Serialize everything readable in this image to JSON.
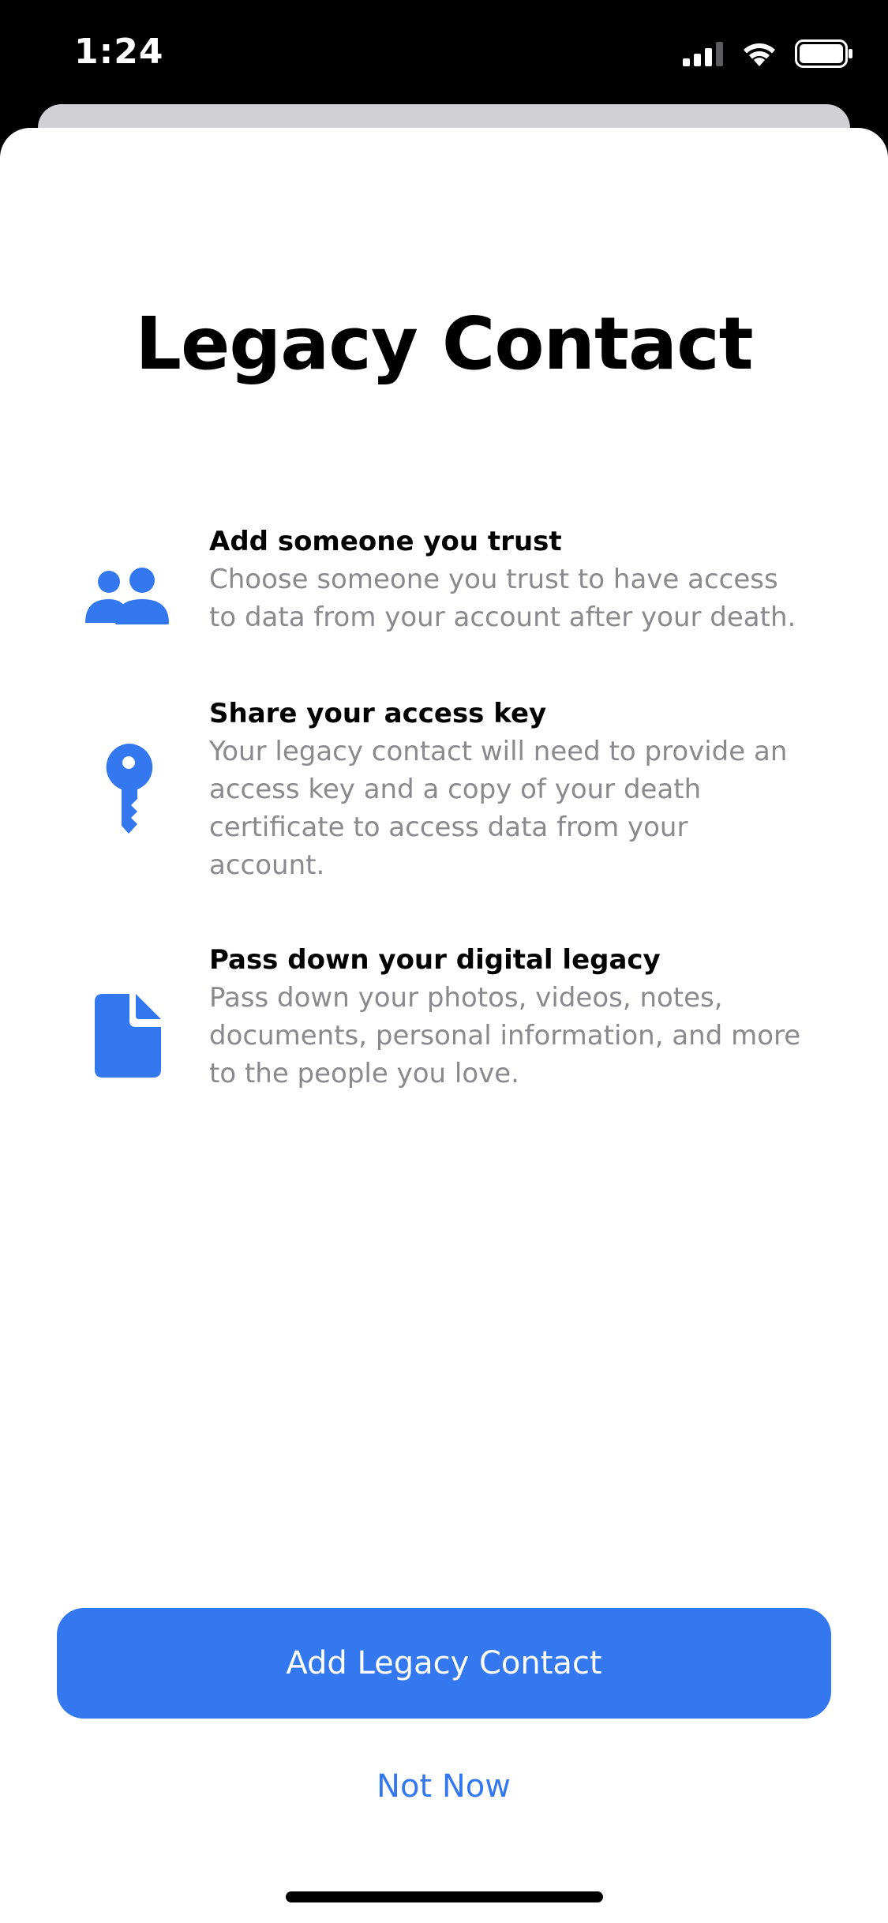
{
  "status_bar": {
    "time": "1:24",
    "icons": [
      "cellular-signal-icon",
      "wifi-icon",
      "battery-icon"
    ]
  },
  "page": {
    "title": "Legacy Contact"
  },
  "features": [
    {
      "icon": "people-icon",
      "title": "Add someone you trust",
      "desc_lines": [
        "Choose someone you trust to have access",
        "to data from your account after your death."
      ]
    },
    {
      "icon": "key-icon",
      "title": "Share your access key",
      "desc_lines": [
        "Your legacy contact will need to provide an",
        "access key and a copy of your death",
        "certificate to access data from your",
        "account."
      ]
    },
    {
      "icon": "document-icon",
      "title": "Pass down your digital legacy",
      "desc_lines": [
        "Pass down your photos, videos, notes,",
        "documents, personal information, and more",
        "to the people you love."
      ]
    }
  ],
  "actions": {
    "primary_label": "Add Legacy Contact",
    "secondary_label": "Not Now"
  },
  "colors": {
    "accent": "#3478f0",
    "secondary_text": "#8a8a8e",
    "background": "#ffffff"
  }
}
